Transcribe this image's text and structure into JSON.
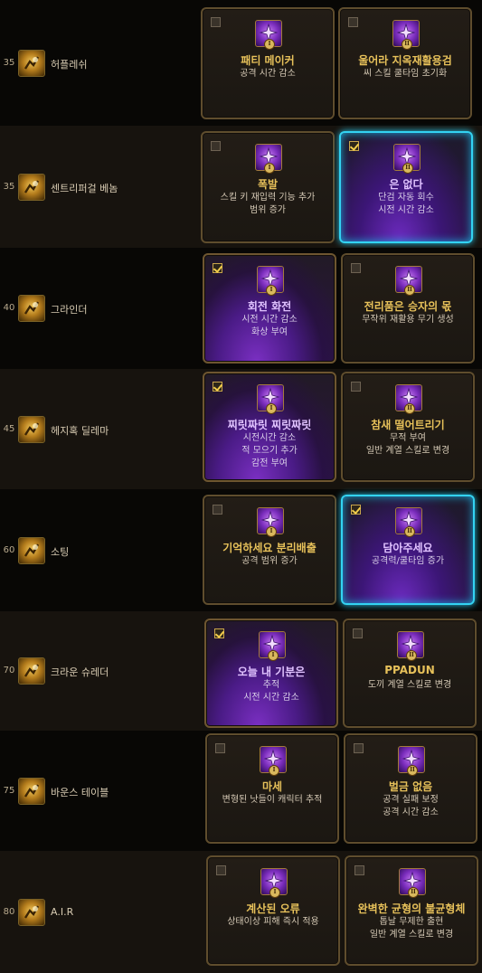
{
  "rows": [
    {
      "level": "35",
      "name": "허플레쉬",
      "icon": "stomp-icon",
      "runes": [
        {
          "title": "패티 메이커",
          "desc": [
            "공격 시간 감소"
          ],
          "selected": false
        },
        {
          "title": "울어라 지옥재활용검",
          "desc": [
            "씨 스킬 쿨타임 초기화"
          ],
          "selected": false
        }
      ]
    },
    {
      "level": "35",
      "name": "센트리퍼걸 베놈",
      "icon": "whirl-icon",
      "runes": [
        {
          "title": "폭발",
          "desc": [
            "스킬 키 재입력 기능 추가",
            "범위 증가"
          ],
          "selected": false
        },
        {
          "title": "은 없다",
          "desc": [
            "단검 자동 회수",
            "시전 시간 감소"
          ],
          "selected": true
        }
      ]
    },
    {
      "level": "40",
      "name": "그라인더",
      "icon": "grinder-icon",
      "runes": [
        {
          "title": "회전 화전",
          "desc": [
            "시전 시간 감소",
            "화상 부여"
          ],
          "selected": true
        },
        {
          "title": "전리품은 승자의 몫",
          "desc": [
            "무작위 재활용 무기 생성"
          ],
          "selected": false
        }
      ]
    },
    {
      "level": "45",
      "name": "헤지혹 딜레마",
      "icon": "hedgehog-icon",
      "runes": [
        {
          "title": "찌릿짜릿 찌릿짜릿",
          "desc": [
            "시전시간 감소",
            "적 모으기 추가",
            "감전 부여"
          ],
          "selected": true
        },
        {
          "title": "참새 떨어트리기",
          "desc": [
            "무적 부여",
            "일반 계열 스킬로 변경"
          ],
          "selected": false
        }
      ]
    },
    {
      "level": "60",
      "name": "소팅",
      "icon": "sorting-icon",
      "runes": [
        {
          "title": "기억하세요 분리배출",
          "desc": [
            "공격 범위 증가"
          ],
          "selected": false
        },
        {
          "title": "담아주세요",
          "desc": [
            "공격력/쿨타임 증가"
          ],
          "selected": true
        }
      ]
    },
    {
      "level": "70",
      "name": "크라운 슈레더",
      "icon": "crown-shredder-icon",
      "runes": [
        {
          "title": "오늘 내 기분은",
          "desc": [
            "추적",
            "시전 시간 감소"
          ],
          "selected": true
        },
        {
          "title": "PPADUN",
          "desc": [
            "도끼 계열 스킬로 변경"
          ],
          "selected": false
        }
      ]
    },
    {
      "level": "75",
      "name": "바운스 테이블",
      "icon": "bounce-table-icon",
      "runes": [
        {
          "title": "마세",
          "desc": [
            "변형된 낫들이 캐릭터 추적"
          ],
          "selected": false
        },
        {
          "title": "벌금 없음",
          "desc": [
            "공격 실패 보정",
            "공격 시간 감소"
          ],
          "selected": false
        }
      ]
    },
    {
      "level": "80",
      "name": "A.I.R",
      "icon": "air-icon",
      "runes": [
        {
          "title": "계산된 오류",
          "desc": [
            "상태이상 피해 즉시 적용"
          ],
          "selected": false
        },
        {
          "title": "완벽한 균형의 불균형체",
          "desc": [
            "톱날 무제한 출현",
            "일반 계열 스킬로 변경"
          ],
          "selected": false
        }
      ]
    }
  ],
  "numerals": [
    "I",
    "II"
  ],
  "colors": {
    "gold": "#e7c15a",
    "selected_border": "#33d3f2",
    "selected_fill": "#4a1b86"
  }
}
